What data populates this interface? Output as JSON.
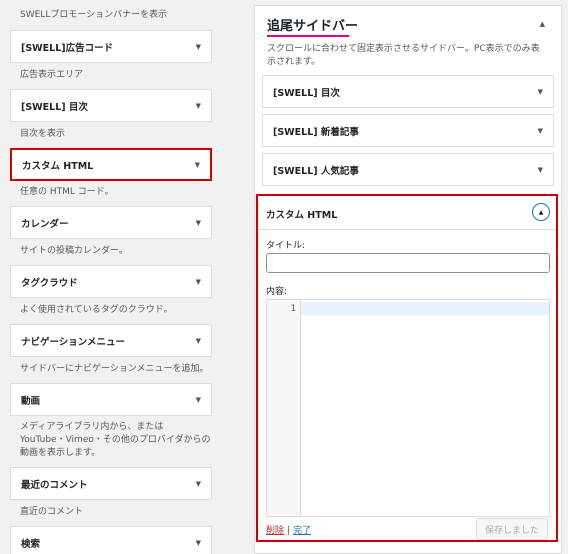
{
  "left_panel": {
    "top_desc": "SWELLプロモーションバナーを表示",
    "widgets": [
      {
        "label": "[SWELL]広告コード",
        "desc": "広告表示エリア"
      },
      {
        "label": "[SWELL] 目次",
        "desc": "目次を表示"
      },
      {
        "label": "カスタム HTML",
        "desc": "任意の HTML コード。"
      },
      {
        "label": "カレンダー",
        "desc": "サイトの投稿カレンダー。"
      },
      {
        "label": "タグクラウド",
        "desc": "よく使用されているタグのクラウド。"
      },
      {
        "label": "ナビゲーションメニュー",
        "desc": "サイドバーにナビゲーションメニューを追加。"
      },
      {
        "label": "動画",
        "desc_lines": [
          "メディアライブラリ内から、または",
          "YouTube・Vimeo・その他のプロバイダからの",
          "動画を表示します。"
        ]
      },
      {
        "label": "最近のコメント",
        "desc": "直近のコメント"
      },
      {
        "label": "検索"
      }
    ]
  },
  "sidebar": {
    "title": "追尾サイドバー",
    "desc": "スクロールに合わせて固定表示させるサイドバー。PC表示でのみ表示されます。",
    "widgets": [
      "[SWELL] 目次",
      "[SWELL] 新着記事",
      "[SWELL] 人気記事"
    ],
    "open_widget": {
      "title": "カスタム HTML",
      "title_label": "タイトル:",
      "content_label": "内容:",
      "line_number": "1",
      "delete_link": "削除",
      "separator": "|",
      "done_link": "完了",
      "save_button": "保存しました"
    }
  },
  "icons": {
    "arrow_down": "▼",
    "arrow_up": "▲"
  },
  "colors": {
    "highlight_border": "#d00000",
    "title_underline": "#e60086",
    "link_blue": "#2271b1",
    "delete_red": "#b32d2e"
  }
}
